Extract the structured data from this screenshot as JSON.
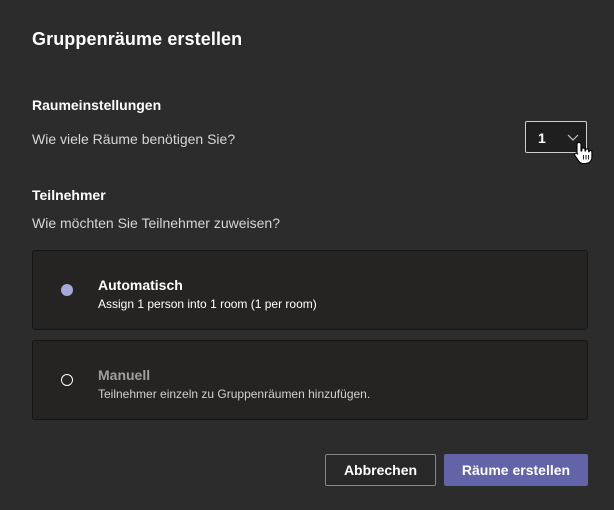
{
  "dialog": {
    "title": "Gruppenräume erstellen"
  },
  "room_settings": {
    "heading": "Raumeinstellungen",
    "question": "Wie viele Räume benötigen Sie?",
    "room_count": "1"
  },
  "participants": {
    "heading": "Teilnehmer",
    "question": "Wie möchten Sie Teilnehmer zuweisen?",
    "options": [
      {
        "title": "Automatisch",
        "description": "Assign 1 person into 1 room (1 per room)",
        "selected": true
      },
      {
        "title": "Manuell",
        "description": "Teilnehmer einzeln zu Gruppenräumen hinzufügen.",
        "selected": false
      }
    ]
  },
  "footer": {
    "cancel_label": "Abbrechen",
    "create_label": "Räume erstellen"
  },
  "colors": {
    "background": "#2d2c2c",
    "card": "#252423",
    "accent": "#6264a7",
    "radio_selected": "#a6a7dc"
  },
  "icons": {
    "dropdown": "chevron-down-icon",
    "cursor": "hand-pointer-icon"
  }
}
